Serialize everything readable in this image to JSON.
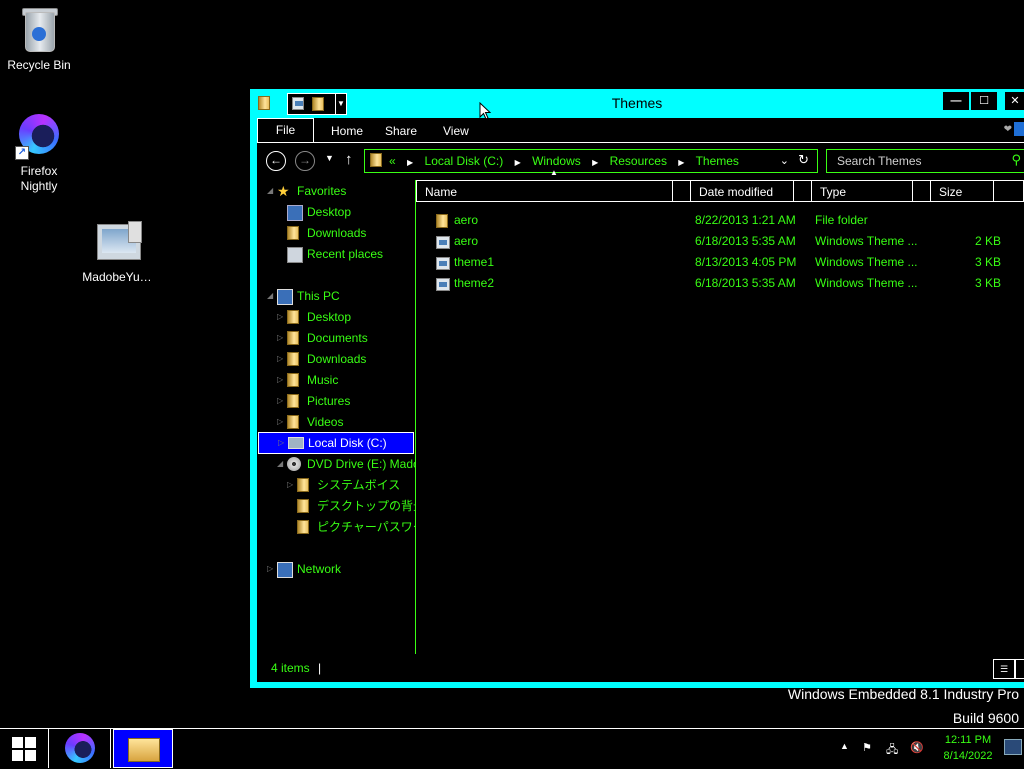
{
  "desktop": {
    "icons": [
      {
        "label": "Recycle Bin",
        "icon": "recycle-bin-icon"
      },
      {
        "label": "Firefox Nightly",
        "label_lines": [
          "Firefox",
          "Nightly"
        ],
        "icon": "firefox-nightly-icon"
      },
      {
        "label": "MadobeYu…",
        "icon": "madobe-shortcut-icon"
      }
    ]
  },
  "window": {
    "title": "Themes",
    "controls": {
      "minimize": "—",
      "maximize": "☐",
      "close": "✕"
    },
    "ribbon": {
      "tabs": [
        "File",
        "Home",
        "Share",
        "View"
      ]
    },
    "address": {
      "lead": "«",
      "crumbs": [
        "Local Disk (C:)",
        "Windows",
        "Resources",
        "Themes"
      ]
    },
    "search": {
      "placeholder": "Search Themes"
    },
    "nav_pane": {
      "favorites": {
        "label": "Favorites",
        "items": [
          "Desktop",
          "Downloads",
          "Recent places"
        ]
      },
      "this_pc": {
        "label": "This PC",
        "items": [
          "Desktop",
          "Documents",
          "Downloads",
          "Music",
          "Pictures",
          "Videos",
          "Local Disk (C:)",
          "DVD Drive (E:) Mado"
        ]
      },
      "dvd_children": [
        "システムボイス",
        "デスクトップの背景",
        "ピクチャーパスワード"
      ],
      "network": "Network",
      "selected": "Local Disk (C:)"
    },
    "columns": {
      "name": "Name",
      "date": "Date modified",
      "type": "Type",
      "size": "Size"
    },
    "files": [
      {
        "name": "aero",
        "date": "8/22/2013 1:21 AM",
        "type": "File folder",
        "size": "",
        "icon": "folder-icon"
      },
      {
        "name": "aero",
        "date": "6/18/2013 5:35 AM",
        "type": "Windows Theme ...",
        "size": "2 KB",
        "icon": "theme-file-icon"
      },
      {
        "name": "theme1",
        "date": "8/13/2013 4:05 PM",
        "type": "Windows Theme ...",
        "size": "3 KB",
        "icon": "theme-file-icon"
      },
      {
        "name": "theme2",
        "date": "6/18/2013 5:35 AM",
        "type": "Windows Theme ...",
        "size": "3 KB",
        "icon": "theme-file-icon"
      }
    ],
    "status": {
      "items": "4 items",
      "divider": "|"
    }
  },
  "watermark": {
    "line1": "Windows Embedded 8.1 Industry Pro",
    "line2": "Build 9600"
  },
  "taskbar": {
    "clock": {
      "time": "12:11 PM",
      "date": "8/14/2022"
    }
  },
  "colors": {
    "accent": "#00ffff",
    "text_green": "#39ff14",
    "selected": "#0000ff",
    "background": "#000000"
  }
}
